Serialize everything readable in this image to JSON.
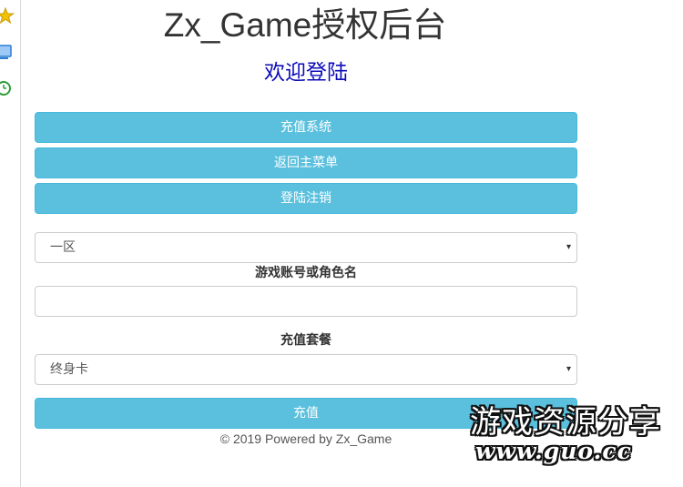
{
  "page": {
    "title": "Zx_Game授权后台",
    "subtitle": "欢迎登陆"
  },
  "menu": {
    "recharge_system": "充值系统",
    "back_to_main": "返回主菜单",
    "logout": "登陆注销"
  },
  "form": {
    "server_select": {
      "selected": "一区"
    },
    "account_label": "游戏账号或角色名",
    "account_input": {
      "value": "",
      "placeholder": ""
    },
    "package_label": "充值套餐",
    "package_select": {
      "selected": "终身卡"
    },
    "submit_label": "充值"
  },
  "footer": {
    "text": "© 2019 Powered by Zx_Game"
  },
  "watermark": {
    "line1": "游戏资源分享",
    "line2": "www.guo.cc"
  },
  "sidebar": {
    "icons": [
      "star-icon",
      "monitor-icon",
      "clock-icon"
    ]
  },
  "colors": {
    "button_bg": "#5bc0de",
    "subtitle": "#0c0cb8",
    "star": "#f2c200",
    "monitor": "#2f7fd6",
    "clock": "#2e9e3a"
  },
  "caret_glyph": "▾"
}
